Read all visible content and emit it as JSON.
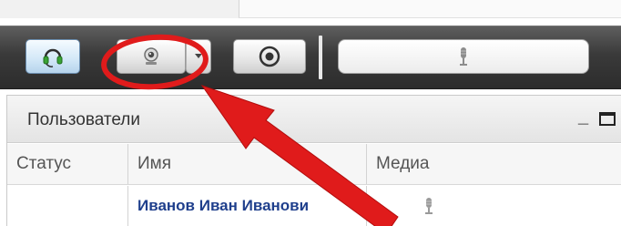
{
  "toolbar": {
    "buttons": [
      {
        "name": "headset-button",
        "icon": "headset-icon"
      },
      {
        "name": "webcam-button",
        "icon": "webcam-icon"
      },
      {
        "name": "webcam-dropdown-button",
        "icon": "chevron-down-icon"
      },
      {
        "name": "record-button",
        "icon": "record-icon"
      }
    ],
    "mic_level_icon": "microphone-icon"
  },
  "annotation": {
    "highlight_color": "#e01b1b"
  },
  "users_panel": {
    "title": "Пользователи",
    "minimize_label": "_",
    "columns": [
      "Статус",
      "Имя",
      "Медиа"
    ],
    "rows": [
      {
        "status": "",
        "name": "Иванов Иван Иванови",
        "media_icon": "microphone-icon"
      }
    ]
  },
  "colors": {
    "toolbar_bg": "#3a3a3a",
    "name_link": "#1f3f8c",
    "headset_accent": "#3aa335"
  }
}
